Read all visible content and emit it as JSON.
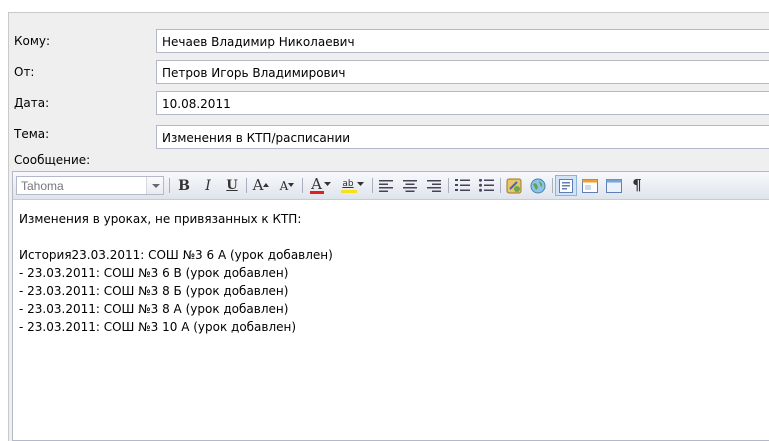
{
  "header": {
    "to_label": "Кому:",
    "to_value": "Нечаев Владимир Николаевич",
    "from_label": "От:",
    "from_value": "Петров Игорь Владимирович",
    "date_label": "Дата:",
    "date_value": "10.08.2011",
    "subject_label": "Тема:",
    "subject_value": "Изменения в КТП/расписании",
    "message_label": "Сообщение:"
  },
  "toolbar": {
    "font": "Tahoma",
    "bold": "B",
    "italic": "I",
    "underline": "U",
    "grow": "A",
    "shrink": "A",
    "forecolor": "A",
    "highlight": "ab",
    "pilcrow": "¶"
  },
  "message": {
    "lines": [
      "Изменения в уроках, не привязанных к КТП:",
      "",
      "История23.03.2011: СОШ №3 6 А (урок добавлен)",
      "- 23.03.2011: СОШ №3 6 В (урок добавлен)",
      "- 23.03.2011: СОШ №3 8 Б (урок добавлен)",
      "- 23.03.2011: СОШ №3 8 А (урок добавлен)",
      "- 23.03.2011: СОШ №3 10 А (урок добавлен)"
    ]
  }
}
